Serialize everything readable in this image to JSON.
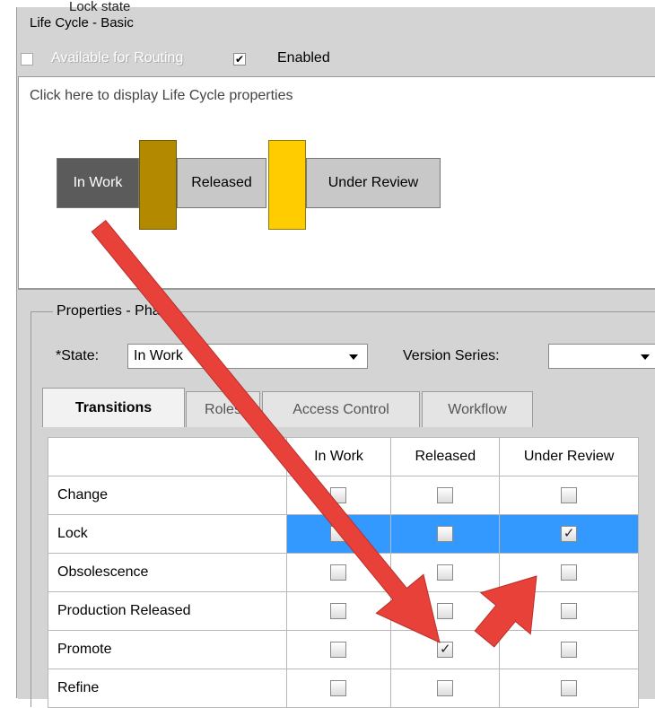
{
  "window": {
    "top_cut_text": "Lock state",
    "title": "Life Cycle - Basic"
  },
  "options": {
    "available_for_routing": {
      "label": "Available for Routing",
      "checked": false,
      "enabled": false
    },
    "enabled": {
      "label": "Enabled",
      "checked": true
    }
  },
  "diagram": {
    "hint": "Click here to display Life Cycle properties",
    "states": [
      "In Work",
      "Released",
      "Under Review"
    ],
    "connector_colors": [
      "#b38900",
      "#ffcc00"
    ],
    "state_colors": {
      "active": "#5b5b5b",
      "normal": "#c8c8c8"
    }
  },
  "properties": {
    "legend": "Properties - Phase",
    "state_label": "*State:",
    "state_value": "In Work",
    "version_series_label": "Version Series:",
    "version_series_value": ""
  },
  "tabs": [
    "Transitions",
    "Roles",
    "Access Control",
    "Workflow"
  ],
  "transitions": {
    "columns": [
      "In Work",
      "Released",
      "Under Review"
    ],
    "rows": [
      {
        "name": "Change",
        "values": [
          false,
          false,
          false
        ]
      },
      {
        "name": "Lock",
        "values": [
          false,
          false,
          true
        ]
      },
      {
        "name": "Obsolescence",
        "values": [
          false,
          false,
          false
        ]
      },
      {
        "name": "Production Released",
        "values": [
          false,
          false,
          false
        ]
      },
      {
        "name": "Promote",
        "values": [
          false,
          true,
          false
        ]
      },
      {
        "name": "Refine",
        "values": [
          false,
          false,
          false
        ]
      }
    ],
    "selected_row": "Lock",
    "selection_color": "#3399ff"
  },
  "annotation_color": "#e8413a"
}
